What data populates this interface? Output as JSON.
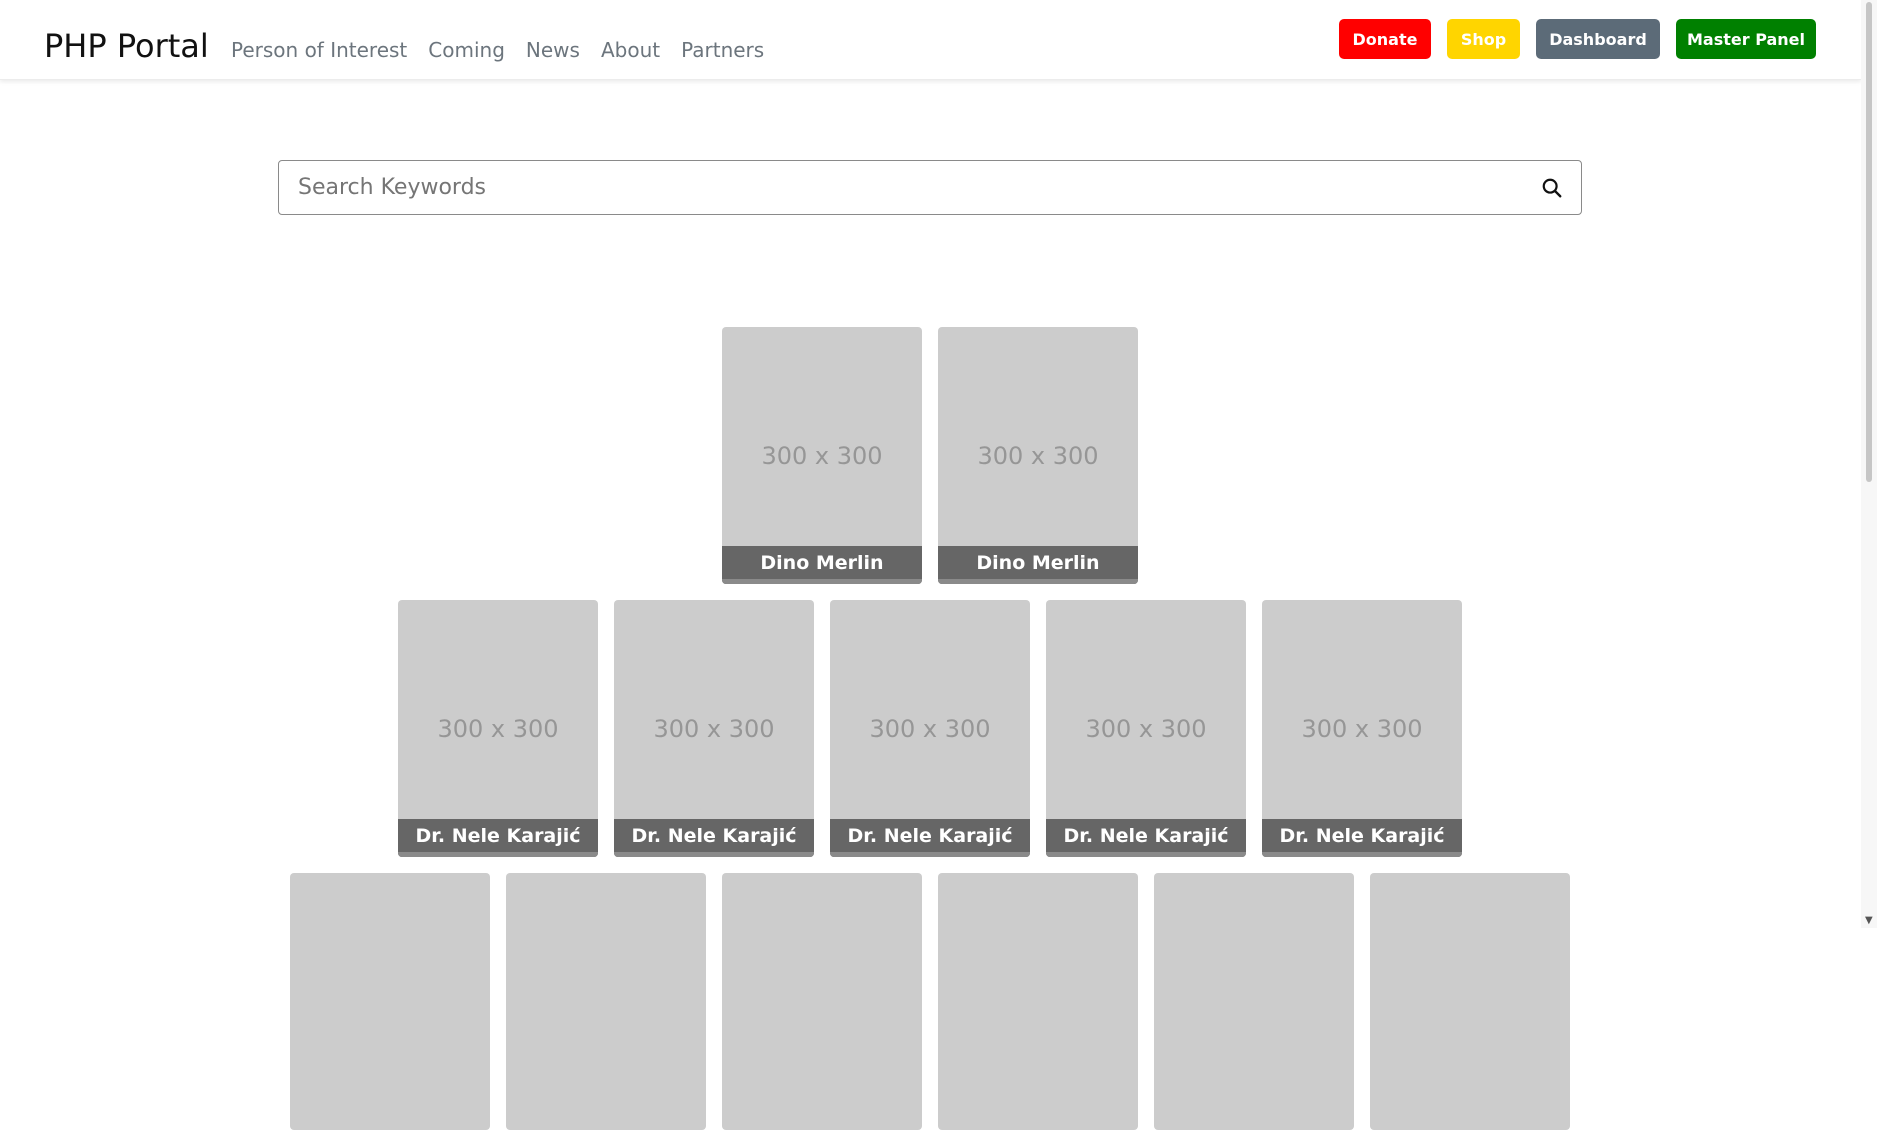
{
  "header": {
    "brand": "PHP Portal",
    "nav": [
      "Person of Interest",
      "Coming",
      "News",
      "About",
      "Partners"
    ],
    "buttons": {
      "donate": "Donate",
      "shop": "Shop",
      "dashboard": "Dashboard",
      "master_panel": "Master Panel"
    }
  },
  "colors": {
    "donate": "#ff0000",
    "shop": "#ffd500",
    "dashboard": "#5c6b78",
    "master_panel": "#008000"
  },
  "search": {
    "placeholder": "Search Keywords",
    "icon": "search-icon"
  },
  "placeholder_text": "300 x 300",
  "rows": [
    {
      "names": [
        "Dino Merlin",
        "Dino Merlin"
      ]
    },
    {
      "names": [
        "Dr. Nele Karajić",
        "Dr. Nele Karajić",
        "Dr. Nele Karajić",
        "Dr. Nele Karajić",
        "Dr. Nele Karajić"
      ]
    },
    {
      "names": [
        "",
        "",
        "",
        "",
        "",
        ""
      ]
    }
  ]
}
